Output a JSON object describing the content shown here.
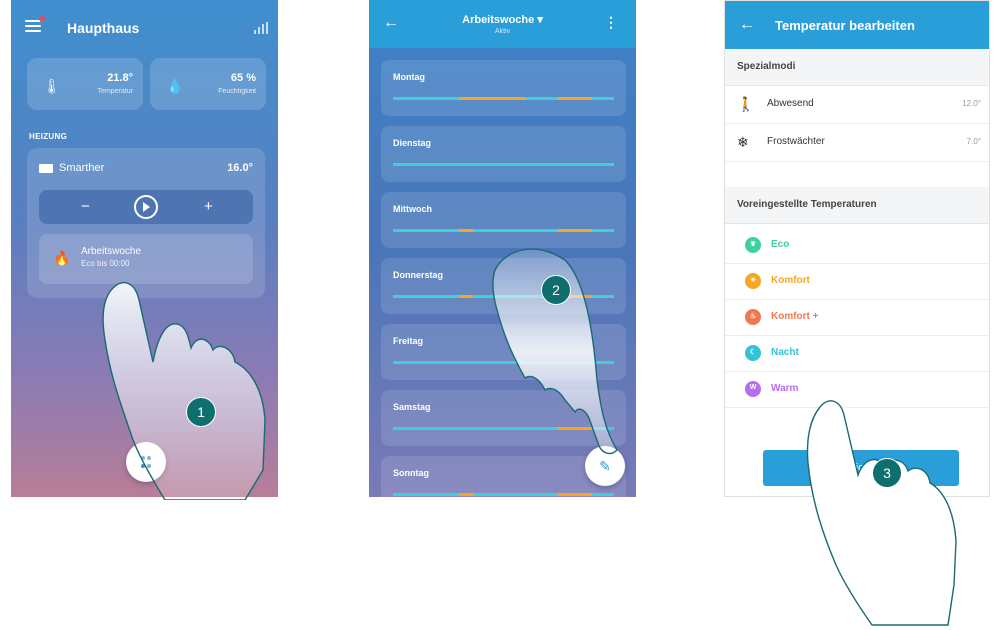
{
  "screen1": {
    "title": "Haupthaus",
    "temperature": {
      "value": "21.8°",
      "label": "Temperatur"
    },
    "humidity": {
      "value": "65 %",
      "label": "Feuchtigkeit"
    },
    "section": "HEIZUNG",
    "device": {
      "name": "Smarther",
      "temp": "16.0°"
    },
    "controls": {
      "minus": "−",
      "plus": "+"
    },
    "program": {
      "name": "Arbeitswoche",
      "status": "Eco bis 00:00"
    }
  },
  "screen2": {
    "title": "Arbeitswoche",
    "subtitle": "Aktiv",
    "days": [
      "Montag",
      "Dienstag",
      "Mittwoch",
      "Donnerstag",
      "Freitag",
      "Samstag",
      "Sonntag"
    ],
    "colors": {
      "eco": "#3fd0d4",
      "komfort": "#f5a623"
    }
  },
  "screen3": {
    "title": "Temperatur bearbeiten",
    "special_section": "Spezialmodi",
    "special": [
      {
        "label": "Abwesend",
        "value": "12.0°",
        "icon": "walking-person-icon"
      },
      {
        "label": "Frostwächter",
        "value": "7.0°",
        "icon": "snowflake-icon"
      }
    ],
    "preset_section": "Voreingestellte Temperaturen",
    "presets": [
      {
        "label": "Eco",
        "color": "#3fd0a0",
        "glyph": "eco"
      },
      {
        "label": "Komfort",
        "color": "#f5a623",
        "glyph": "sun"
      },
      {
        "label": "Komfort +",
        "color": "#f07850",
        "glyph": "flame"
      },
      {
        "label": "Nacht",
        "color": "#33c3d6",
        "glyph": "moon"
      },
      {
        "label": "Warm",
        "color": "#b86cf0",
        "glyph": "W"
      }
    ],
    "save_button": "Speichern"
  },
  "steps": [
    "1",
    "2",
    "3"
  ]
}
